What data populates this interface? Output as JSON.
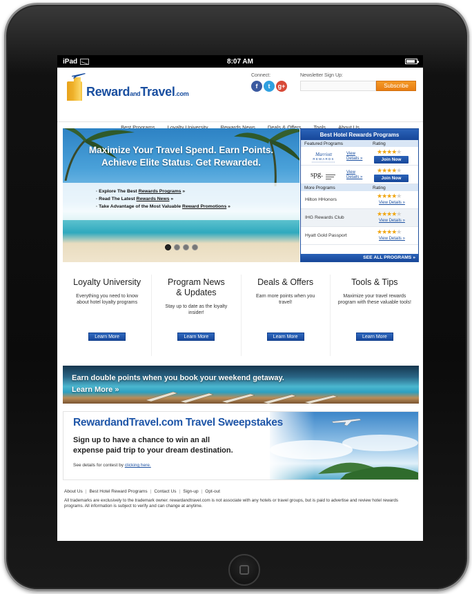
{
  "device": {
    "status": {
      "carrier": "iPad",
      "time": "8:07 AM"
    }
  },
  "header": {
    "logo_reward": "Reward",
    "logo_and": "and",
    "logo_travel": "Travel",
    "logo_com": ".com",
    "connect_label": "Connect:",
    "social": {
      "facebook": "f",
      "twitter": "t",
      "gplus": "g+"
    },
    "newsletter_label": "Newsletter Sign Up:",
    "newsletter_placeholder": "",
    "subscribe_label": "Subscribe"
  },
  "nav": {
    "items": [
      "Best Programs",
      "Loyalty University",
      "Rewards News",
      "Deals & Offers",
      "Tools",
      "About Us"
    ]
  },
  "hero": {
    "title_line1": "Maximize Your Travel Spend. Earn Points.",
    "title_line2": "Achieve Elite Status. Get Rewarded.",
    "bullets": [
      {
        "prefix": "Explore The Best ",
        "link": "Rewards Programs",
        "suffix": " »"
      },
      {
        "prefix": "Read The Latest ",
        "link": "Rewards News",
        "suffix": " »"
      },
      {
        "prefix": "Take Advantage of the Most Valuable ",
        "link": "Reward Promotions",
        "suffix": " »"
      }
    ]
  },
  "hotel": {
    "heading": "Best Hotel Rewards Programs",
    "featured_label": "Featured Programs",
    "rating_label": "Rating",
    "more_label": "More Programs",
    "featured": [
      {
        "logo": "Marriott REWARDS",
        "view": "View",
        "details": "Details »",
        "rating": 4,
        "join": "Join Now"
      },
      {
        "logo": "SPG",
        "view": "View",
        "details": "Details »",
        "rating": 4,
        "join": "Join Now"
      }
    ],
    "more": [
      {
        "name": "Hilton HHonors",
        "rating": 4,
        "view_details": "View Details »"
      },
      {
        "name": "IHG Rewards Club",
        "rating": 4,
        "view_details": "View Details »"
      },
      {
        "name": "Hyatt Gold Passport",
        "rating": 4,
        "view_details": "View Details »"
      }
    ],
    "see_all": "SEE ALL PROGRAMS »"
  },
  "features": [
    {
      "title": "Loyalty University",
      "text": "Everything you need to know about hotel loyalty programs",
      "button": "Learn More"
    },
    {
      "title": "Program News & Updates",
      "text": "Stay up to date as the loyalty insider!",
      "button": "Learn More"
    },
    {
      "title": "Deals & Offers",
      "text": "Earn more points when you travel!",
      "button": "Learn More"
    },
    {
      "title": "Tools & Tips",
      "text": "Maximize your  travel rewards program with these valuable tools!",
      "button": "Learn More"
    }
  ],
  "pool_banner": {
    "headline": "Earn double points when you book your weekend getaway.",
    "cta": "Learn More »"
  },
  "sweepstakes": {
    "title": "RewardandTravel.com Travel Sweepstakes",
    "subtitle": "Sign up to have a chance to win an all expense paid trip to your dream destination.",
    "details_prefix": "See details for contest by ",
    "details_link": "clicking here."
  },
  "footer": {
    "links": [
      "About Us",
      "Best Hotel Reward Programs",
      "Contact Us",
      "Sign-up",
      "Opt-out"
    ],
    "note": "All trademarks are exclusively to the trademark owner. rewardandtravel.com is not associate with any hotels or travel groups, but is paid to advertise and review hotel rewards programs. All information is subject to verify and can change at anytime."
  },
  "colors": {
    "brand_blue": "#1a4fa0",
    "accent_orange": "#f49a28",
    "star": "#f0a612"
  }
}
